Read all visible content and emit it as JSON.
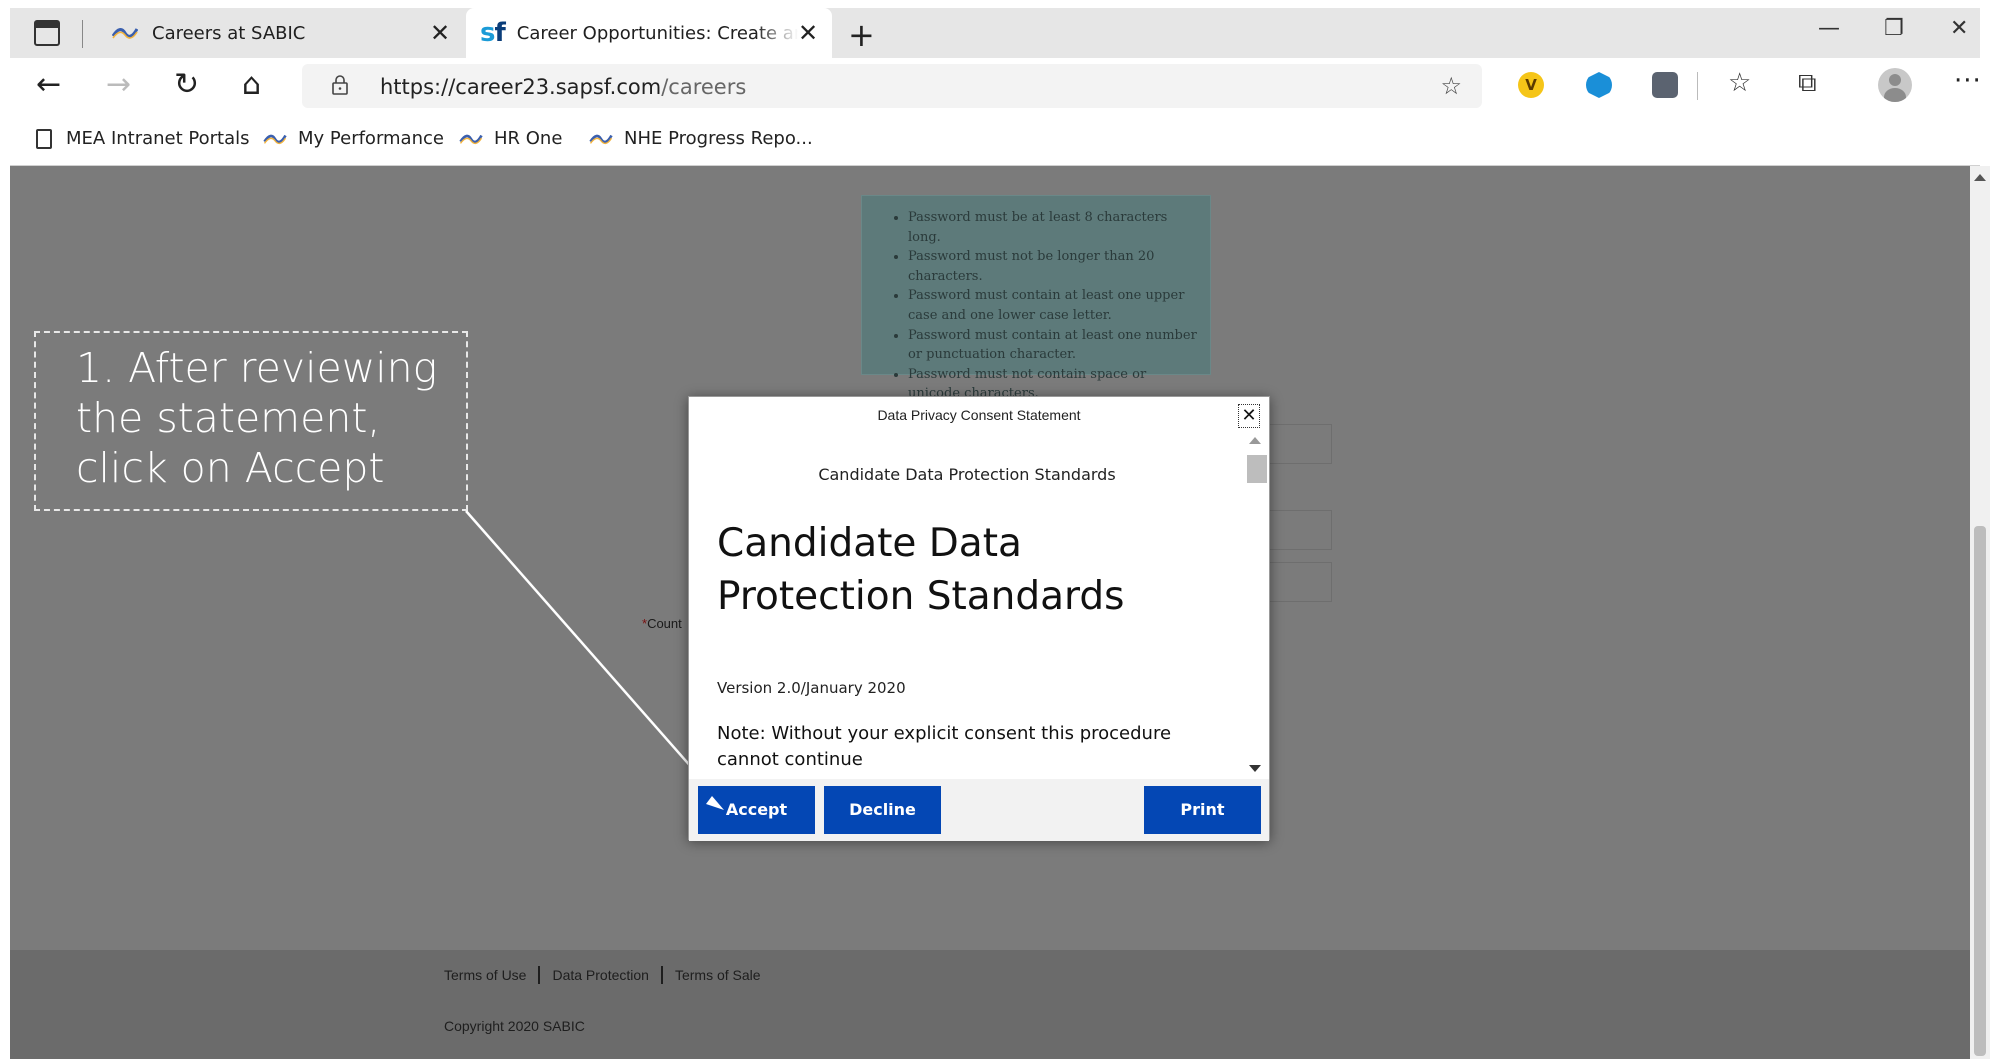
{
  "browser": {
    "tabs": [
      {
        "title": "Careers at SABIC",
        "favicon": "sabic-wave-icon"
      },
      {
        "title": "Career Opportunities: Create an Account",
        "favicon": "sf-logo-icon",
        "favicon_text_s": "s",
        "favicon_text_f": "f",
        "active": true
      }
    ],
    "url_host": "https://career23.sapsf.com",
    "url_path": "/careers",
    "extensions": {
      "v_label": "V"
    },
    "bookmarks": [
      {
        "label": "MEA Intranet Portals",
        "icon": "page-icon"
      },
      {
        "label": "My Performance",
        "icon": "sabic-wave-icon"
      },
      {
        "label": "HR One",
        "icon": "sabic-wave-icon"
      },
      {
        "label": "NHE Progress Repo...",
        "icon": "sabic-wave-icon"
      }
    ]
  },
  "page": {
    "password_rules": [
      "Password must be at least 8 characters long.",
      "Password must not be longer than 20 characters.",
      "Password must contain at least one upper case and one lower case letter.",
      "Password must contain at least one number or punctuation character.",
      "Password must not contain space or unicode characters."
    ],
    "country_required_mark": "*",
    "country_label_visible": "Count",
    "footer": {
      "links": [
        "Terms of Use",
        "Data Protection",
        "Terms of Sale"
      ],
      "copyright": "Copyright 2020 SABIC"
    }
  },
  "modal": {
    "title": "Data Privacy Consent Statement",
    "close_glyph": "✕",
    "subheading": "Candidate Data Protection Standards",
    "heading": "Candidate Data Protection Standards",
    "version": "Version 2.0/January 2020",
    "note": "Note: Without your explicit consent this procedure cannot continue",
    "buttons": {
      "accept": "Accept",
      "decline": "Decline",
      "print": "Print"
    }
  },
  "annotation": {
    "text": "1. After reviewing the statement, click on Accept"
  },
  "colors": {
    "button_blue": "#0447b4",
    "overlay_gray": "#7b7b7b",
    "sf_blue": "#1b9bd7"
  }
}
